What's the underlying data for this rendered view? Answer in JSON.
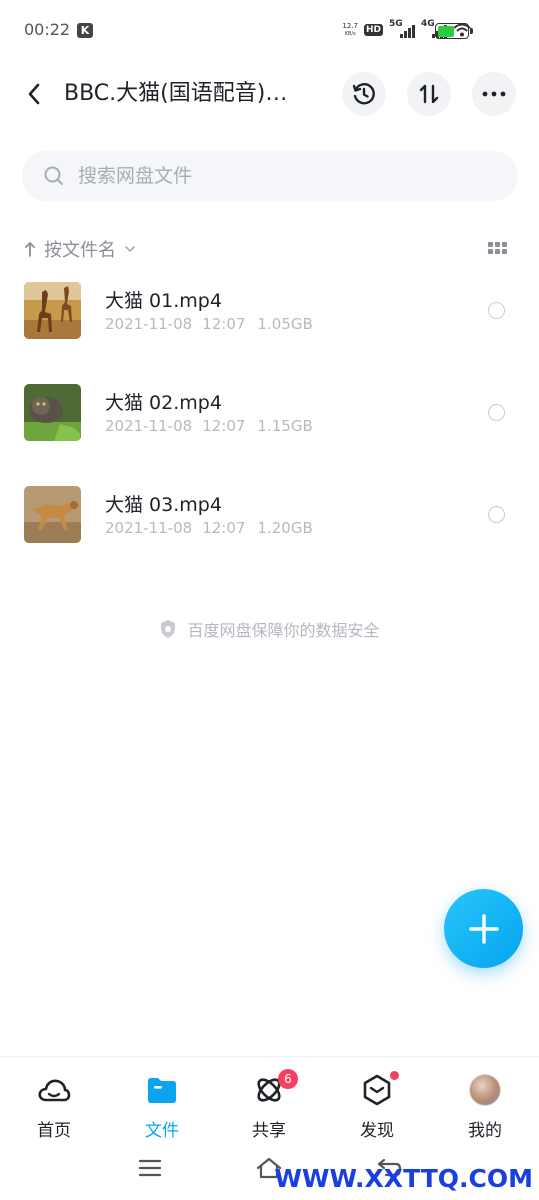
{
  "status_bar": {
    "time": "00:22",
    "app_indicator": "K",
    "net_speed_value": "12.7",
    "net_speed_unit": "KB/s",
    "hd_label": "HD",
    "signal1_label": "5G",
    "signal2_label": "4G",
    "battery_level": 0.58,
    "battery_color": "#2ecc40"
  },
  "header": {
    "title": "BBC.大猫(国语配音)…",
    "back_icon": "chevron-left-icon",
    "history_icon": "history-icon",
    "transfer_icon": "transfer-icon",
    "more_icon": "more-icon"
  },
  "search": {
    "placeholder": "搜索网盘文件",
    "icon": "search-icon"
  },
  "sort": {
    "label": "按文件名",
    "arrow_icon": "sort-arrow-up-icon",
    "dropdown_icon": "chevron-down-icon",
    "view_icon": "grid-view-icon"
  },
  "files": [
    {
      "name": "大猫 01.mp4",
      "date": "2021-11-08",
      "time": "12:07",
      "size": "1.05GB",
      "thumb": "giraffe-savanna"
    },
    {
      "name": "大猫 02.mp4",
      "date": "2021-11-08",
      "time": "12:07",
      "size": "1.15GB",
      "thumb": "wild-cat-grass"
    },
    {
      "name": "大猫 03.mp4",
      "date": "2021-11-08",
      "time": "12:07",
      "size": "1.20GB",
      "thumb": "cheetah-running"
    }
  ],
  "footer_note": "百度网盘保障你的数据安全",
  "fab": {
    "icon": "plus-icon"
  },
  "bottom_nav": {
    "items": [
      {
        "label": "首页",
        "icon": "cloud-icon",
        "active": false
      },
      {
        "label": "文件",
        "icon": "folder-icon",
        "active": true
      },
      {
        "label": "共享",
        "icon": "share-atom-icon",
        "active": false,
        "badge": "6"
      },
      {
        "label": "发现",
        "icon": "discover-hexagon-icon",
        "active": false,
        "dot": true
      },
      {
        "label": "我的",
        "icon": "avatar",
        "active": false
      }
    ]
  },
  "watermark": "WWW.XXTTQ.COM",
  "colors": {
    "accent": "#0aa4f0",
    "badge": "#f5405f",
    "text_primary": "#1f2329",
    "text_secondary": "#b6bac1"
  }
}
